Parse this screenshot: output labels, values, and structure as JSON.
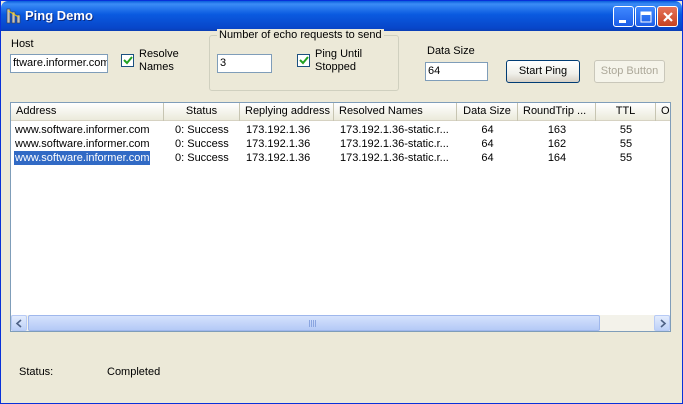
{
  "window": {
    "title": "Ping Demo"
  },
  "host": {
    "label": "Host",
    "value": "ftware.informer.com"
  },
  "resolve_names": {
    "label_line1": "Resolve",
    "label_line2": "Names",
    "checked": true
  },
  "echo_group": {
    "title": "Number of echo requests to send",
    "count_value": "3",
    "ping_until_line1": "Ping Until",
    "ping_until_line2": "Stopped",
    "ping_until_checked": true
  },
  "data_size": {
    "label": "Data Size",
    "value": "64"
  },
  "buttons": {
    "start": "Start Ping",
    "stop": "Stop Button"
  },
  "list": {
    "columns": [
      "Address",
      "Status",
      "Replying address",
      "Resolved Names",
      "Data Size",
      "RoundTrip ...",
      "TTL",
      "O"
    ],
    "rows": [
      [
        "www.software.informer.com",
        "0: Success",
        "173.192.1.36",
        "173.192.1.36-static.r...",
        "64",
        "163",
        "55"
      ],
      [
        "www.software.informer.com",
        "0: Success",
        "173.192.1.36",
        "173.192.1.36-static.r...",
        "64",
        "162",
        "55"
      ],
      [
        "www.software.informer.com",
        "0: Success",
        "173.192.1.36",
        "173.192.1.36-static.r...",
        "64",
        "164",
        "55"
      ]
    ],
    "selected_row": 2
  },
  "status": {
    "label": "Status:",
    "value": "Completed"
  },
  "colors": {
    "title_bar": "#0a5ae0",
    "selection": "#316ac5",
    "window_bg": "#ece9d8"
  },
  "icons": [
    "network-app-icon",
    "minimize-icon",
    "maximize-icon",
    "close-icon",
    "checkmark-icon",
    "scroll-left-icon",
    "scroll-right-icon"
  ]
}
